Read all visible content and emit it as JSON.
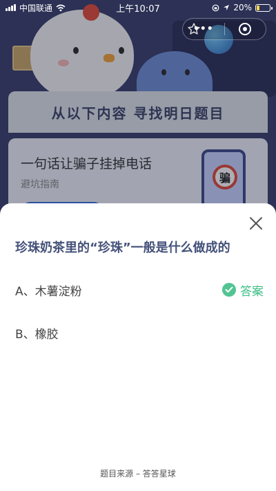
{
  "status_bar": {
    "carrier": "中国联通",
    "time": "上午10:07",
    "battery": "20%",
    "battery_level": 0.2
  },
  "nav": {
    "star_icon": "star-outline-icon",
    "more_icon": "more-dots-icon",
    "close_icon": "circle-close-icon",
    "more_label": "•••"
  },
  "banner": {
    "title": "从以下内容 寻找明日题目"
  },
  "feature_card": {
    "title": "一句话让骗子挂掉电话",
    "subtitle": "避坑指南",
    "badge_text": "骗"
  },
  "quiz": {
    "question": "珍珠奶茶里的“珍珠”一般是什么做成的",
    "options": [
      {
        "label": "A、木薯淀粉",
        "is_answer": true
      },
      {
        "label": "B、橡胶",
        "is_answer": false
      }
    ],
    "answer_tag": "答案",
    "footer": "题目来源 – 答答星球"
  },
  "colors": {
    "accent_green": "#52c494",
    "question_text": "#44517a",
    "background_dark": "#3a3f6e"
  }
}
